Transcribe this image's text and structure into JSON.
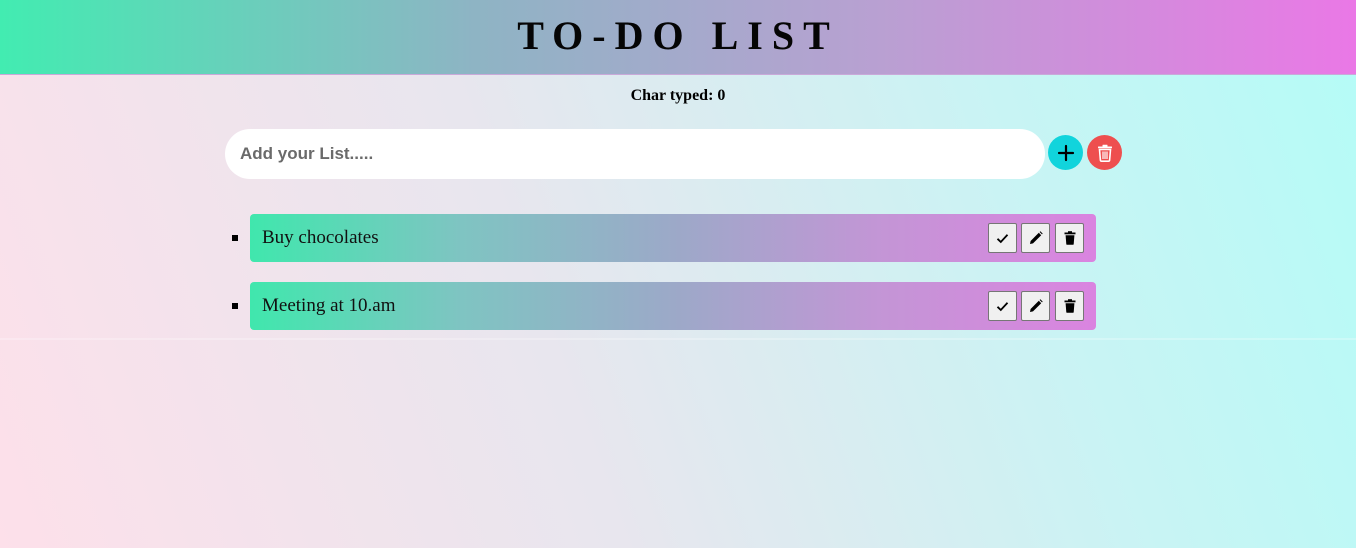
{
  "header": {
    "title": "TO-DO LIST"
  },
  "counter": {
    "text": "Char typed: 0"
  },
  "input": {
    "value": "",
    "placeholder": "Add your List....."
  },
  "buttons": {
    "add_icon": "plus-icon",
    "clear_icon": "trash-icon"
  },
  "todos": [
    {
      "text": "Buy chocolates"
    },
    {
      "text": "Meeting at 10.am"
    }
  ],
  "item_actions": [
    "check-icon",
    "pencil-icon",
    "trash-icon"
  ],
  "colors": {
    "header_start": "#42ecb1",
    "header_end": "#ea78e6",
    "add_button": "#11d4dc",
    "clear_button": "#ee4f4f"
  }
}
